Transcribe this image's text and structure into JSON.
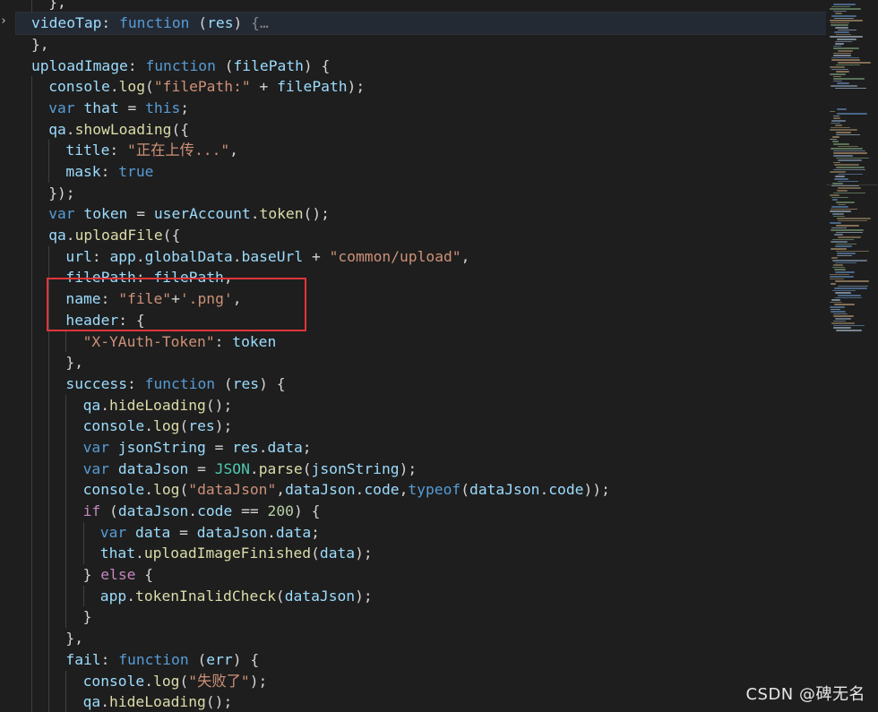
{
  "code_lines": [
    "},",
    "videoTap: function (res) {…",
    "},",
    "uploadImage: function (filePath) {",
    "console.log(\"filePath:\" + filePath);",
    "var that = this;",
    "qa.showLoading({",
    "title: \"正在上传...\",",
    "mask: true",
    "});",
    "var token = userAccount.token();",
    "qa.uploadFile({",
    "url: app.globalData.baseUrl + \"common/upload\",",
    "filePath: filePath,",
    "name: \"file\"+'.png',",
    "header: {",
    "\"X-YAuth-Token\": token",
    "},",
    "success: function (res) {",
    "qa.hideLoading();",
    "console.log(res);",
    "var jsonString = res.data;",
    "var dataJson = JSON.parse(jsonString);",
    "console.log(\"dataJson\",dataJson.code,typeof(dataJson.code));",
    "if (dataJson.code == 200) {",
    "var data = dataJson.data;",
    "that.uploadImageFinished(data);",
    "} else {",
    "app.tokenInalidCheck(dataJson);",
    "}",
    "},",
    "fail: function (err) {",
    "console.log(\"失败了\");",
    "qa.hideLoading();"
  ],
  "watermark": "CSDN @碑无名",
  "colors": {
    "background": "#1e1e1e",
    "keyword": "#569cd6",
    "property": "#9cdcfe",
    "function": "#dcdcaa",
    "string": "#ce9178",
    "control": "#c586c0",
    "class": "#4ec9b0",
    "highlight_box": "#e0353a"
  }
}
